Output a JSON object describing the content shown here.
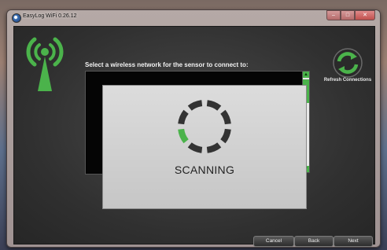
{
  "window": {
    "title": "EasyLog WiFi 0.26.12"
  },
  "caption_buttons": {
    "minimize": "–",
    "maximize": "□",
    "close": "✕"
  },
  "main": {
    "instruction": "Select a wireless network for the sensor to connect to:",
    "refresh_label": "Refresh Connections"
  },
  "scan_dialog": {
    "status": "SCANNING",
    "spinner_segments": 8,
    "spinner_active_segment": 5
  },
  "footer": {
    "cancel_label": "Cancel",
    "back_label": "Back",
    "next_label": "Next"
  },
  "icons": {
    "app": "app-icon",
    "antenna": "wifi-antenna-icon",
    "refresh": "refresh-icon",
    "spinner": "loading-spinner-icon",
    "scroll_up": "arrow-up-icon",
    "scroll_down": "arrow-down-icon"
  },
  "colors": {
    "accent_green": "#4bb34b",
    "client_bg": "#303030",
    "dialog_bg": "#d2d2d2",
    "spinner_inactive": "#333333"
  }
}
